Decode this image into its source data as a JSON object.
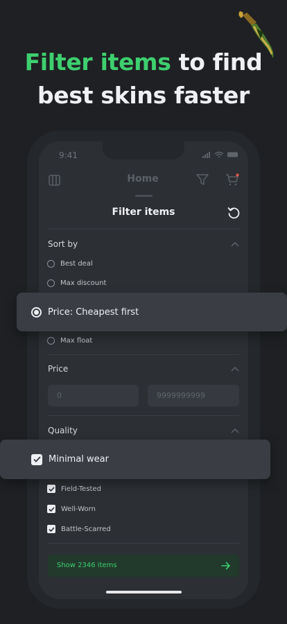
{
  "headline": {
    "accent": "Filter items",
    "rest_line1": " to find",
    "line2": "best skins faster"
  },
  "status_bar": {
    "time": "9:41"
  },
  "top_bar": {
    "title": "Home"
  },
  "sheet": {
    "title": "Filter items"
  },
  "sort": {
    "title": "Sort by",
    "options": [
      {
        "label": "Best deal",
        "selected": false
      },
      {
        "label": "Max discount",
        "selected": false
      },
      {
        "label": "Price: Cheapest first",
        "selected": true
      },
      {
        "label": "Max float",
        "selected": false
      }
    ]
  },
  "price": {
    "title": "Price",
    "min_placeholder": "0",
    "max_placeholder": "9999999999"
  },
  "quality": {
    "title": "Quality",
    "options": [
      {
        "label": "Minimal wear",
        "checked": true
      },
      {
        "label": "Field-Tested",
        "checked": true
      },
      {
        "label": "Well-Worn",
        "checked": true
      },
      {
        "label": "Battle-Scarred",
        "checked": true
      }
    ]
  },
  "show_button": {
    "label": "Show 2346 items"
  },
  "colors": {
    "accent": "#3ecf6f",
    "background": "#1e2023",
    "sheet": "#2c2f34",
    "cart_badge": "#e0564b"
  }
}
